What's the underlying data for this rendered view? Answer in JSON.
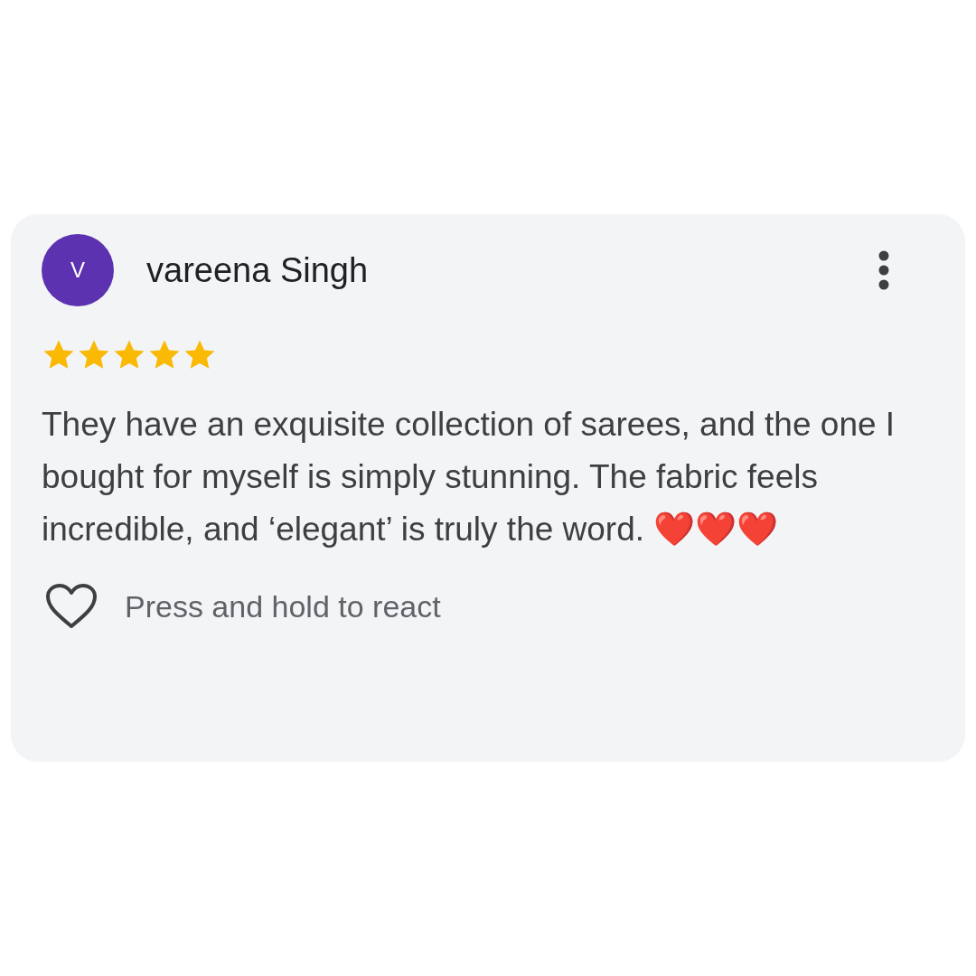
{
  "review": {
    "avatar_letter": "V",
    "author": "vareena Singh",
    "stars": 5,
    "text": "They have an exquisite collection of sarees, and the one I bought for myself is simply stunning. The fabric feels incredible, and ‘elegant’ is truly the word. ❤️❤️❤️",
    "react_hint": "Press and hold to react"
  }
}
